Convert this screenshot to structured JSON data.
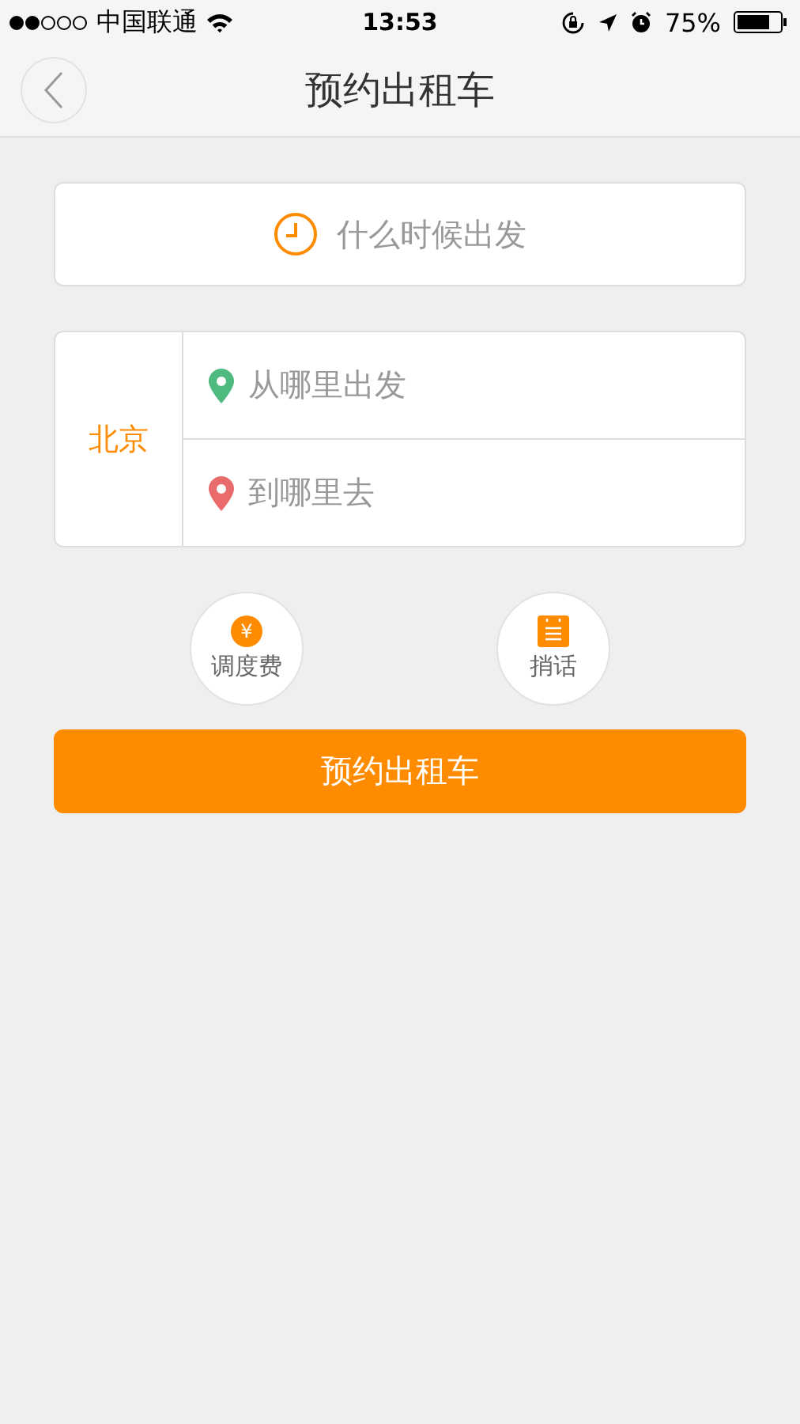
{
  "status_bar": {
    "carrier": "中国联通",
    "time": "13:53",
    "battery": "75%"
  },
  "nav": {
    "title": "预约出租车"
  },
  "time_field": {
    "placeholder": "什么时候出发"
  },
  "address": {
    "city": "北京",
    "from_placeholder": "从哪里出发",
    "to_placeholder": "到哪里去"
  },
  "options": [
    {
      "kind": "fee",
      "icon": "¥",
      "label": "调度费"
    },
    {
      "kind": "message",
      "label": "捎话"
    }
  ],
  "submit": "预约出租车"
}
